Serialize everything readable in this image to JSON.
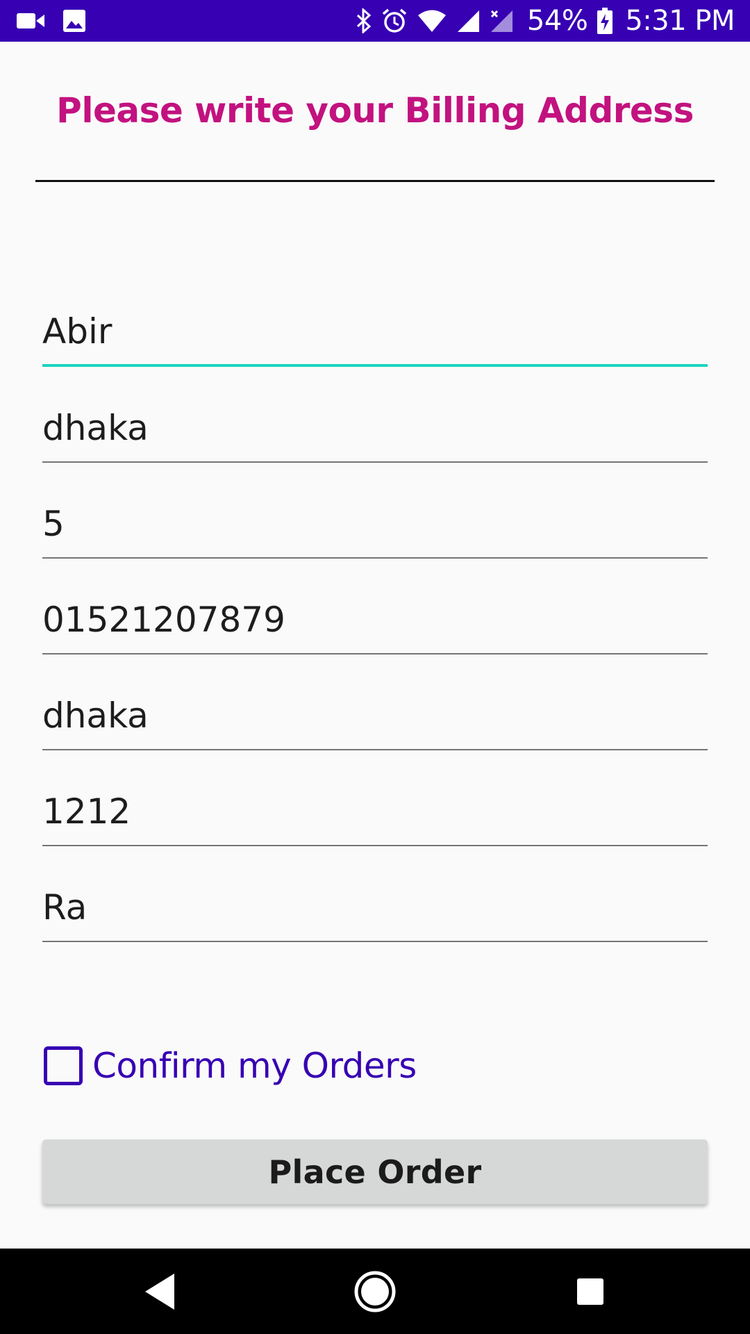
{
  "status_bar": {
    "battery": "54%",
    "time": "5:31 PM",
    "icons": [
      "video-camera-icon",
      "image-icon",
      "bluetooth-icon",
      "alarm-icon",
      "wifi-icon",
      "signal-icon",
      "signal-no-data-icon",
      "battery-charging-icon"
    ],
    "background_color": "#3700b3"
  },
  "header": {
    "title": "Please write your Billing Address",
    "title_color": "#c2127f"
  },
  "form": {
    "fields": [
      {
        "value": "Abir",
        "active": true
      },
      {
        "value": "dhaka",
        "active": false
      },
      {
        "value": "5",
        "active": false
      },
      {
        "value": "01521207879",
        "active": false
      },
      {
        "value": "dhaka",
        "active": false
      },
      {
        "value": "1212",
        "active": false
      },
      {
        "value": "Ra",
        "active": false
      }
    ],
    "active_underline_color": "#1ad5c0",
    "confirm": {
      "label": "Confirm my Orders",
      "checked": false,
      "color": "#3700b3"
    },
    "submit_label": "Place Order"
  },
  "nav_bar": {
    "icons": [
      "back-icon",
      "home-icon",
      "recent-apps-icon"
    ]
  }
}
